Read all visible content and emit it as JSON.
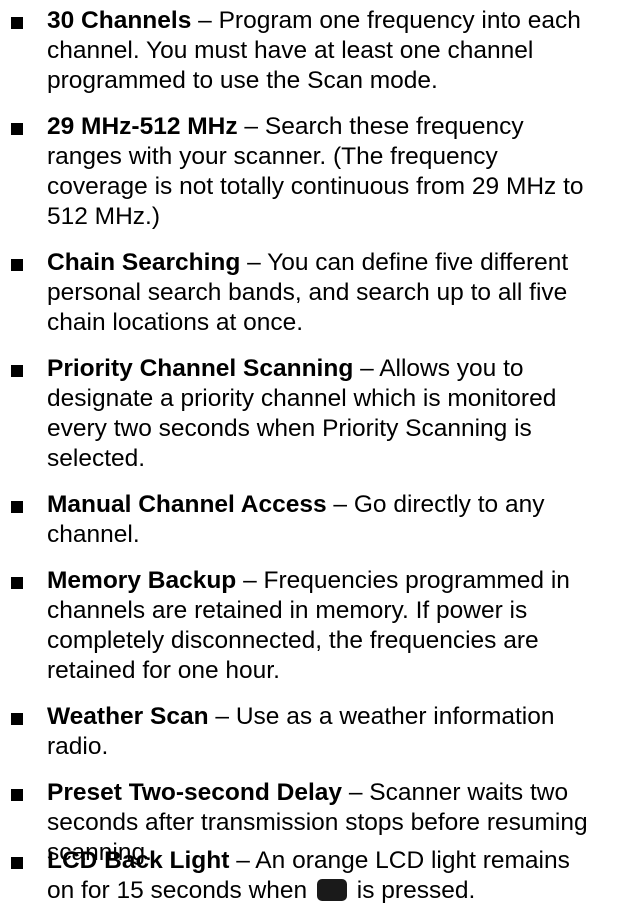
{
  "features": [
    {
      "title": "30 Channels",
      "separator": " – ",
      "lines_first": "Program one frequency into each",
      "lines": [
        "channel. You must have at least one channel",
        "programmed to use the Scan mode."
      ]
    },
    {
      "title": "29 MHz-512 MHz",
      "separator": " – ",
      "lines_first": "Search these frequency",
      "lines": [
        "ranges with your scanner. (The frequency",
        "coverage is not totally continuous from 29 MHz to",
        "512 MHz.)"
      ]
    },
    {
      "title": "Chain Searching",
      "separator": " – ",
      "lines_first": "You can define five different",
      "lines": [
        "personal search bands, and search up to all five",
        "chain locations at once."
      ]
    },
    {
      "title": "Priority Channel Scanning",
      "separator": " – ",
      "lines_first": "Allows you to",
      "lines": [
        "designate a priority channel which is monitored",
        "every two seconds when Priority Scanning is",
        "selected."
      ]
    },
    {
      "title": "Manual Channel Access",
      "separator": " – ",
      "lines_first": "Go directly to any",
      "lines": [
        "channel."
      ]
    },
    {
      "title": "Memory Backup",
      "separator": " – ",
      "lines_first": "Frequencies programmed in",
      "lines": [
        "channels are retained in memory. If power is",
        "completely disconnected, the frequencies are",
        "retained for one hour."
      ]
    },
    {
      "title": "Weather Scan",
      "separator": " – ",
      "lines_first": "Use as a weather information",
      "lines": [
        "radio."
      ]
    },
    {
      "title": "Preset Two-second Delay",
      "separator": " – ",
      "lines_first": "Scanner waits two",
      "lines": [
        "seconds after transmission stops before resuming",
        "scanning."
      ]
    },
    {
      "title": "LCD Back Light",
      "separator": " – ",
      "lines_first": "An orange LCD light remains",
      "last_line_before": "on for 15 seconds when",
      "last_line_after": "is pressed.",
      "key_icon": "light-key-icon"
    }
  ]
}
